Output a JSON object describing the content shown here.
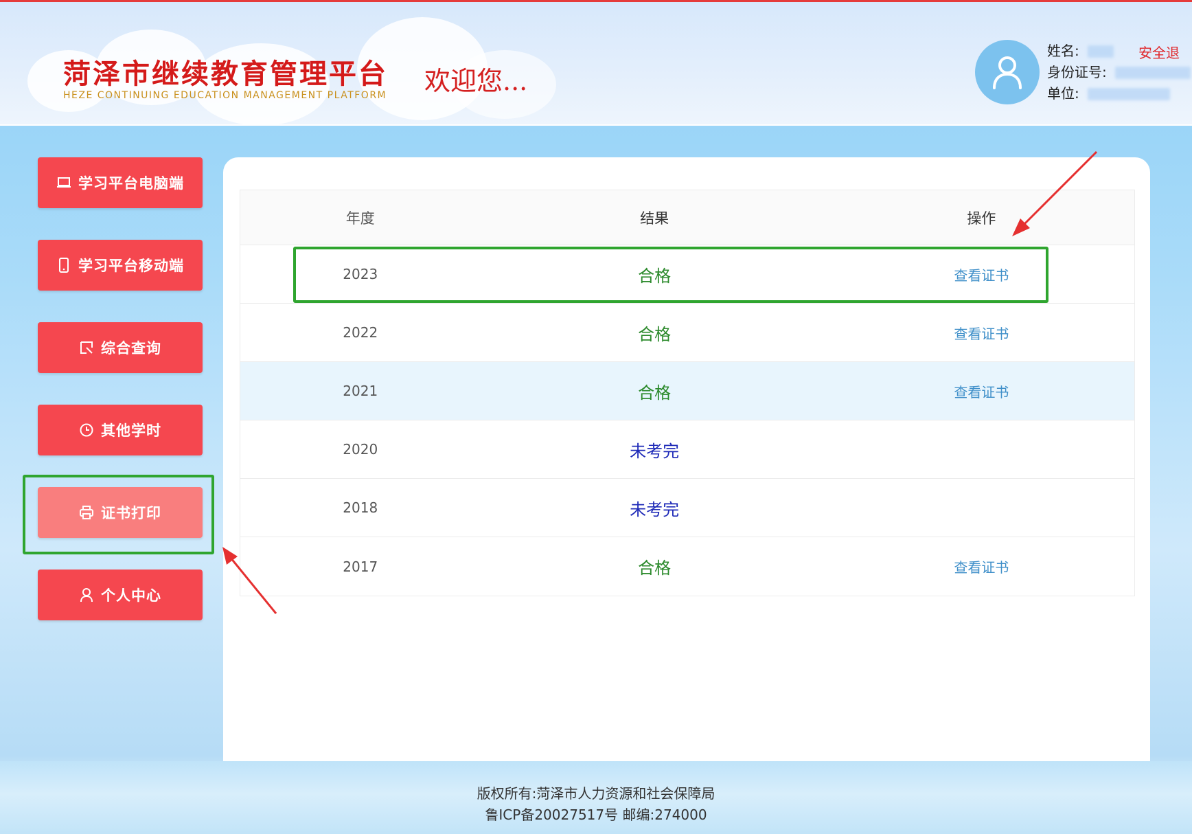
{
  "header": {
    "title": "菏泽市继续教育管理平台",
    "subtitle": "HEZE CONTINUING EDUCATION MANAGEMENT PLATFORM",
    "welcome": "欢迎您...",
    "user": {
      "name_label": "姓名:",
      "id_label": "身份证号:",
      "unit_label": "单位:",
      "logout": "安全退"
    }
  },
  "sidebar": {
    "items": [
      {
        "label": "学习平台电脑端",
        "icon": "laptop-icon"
      },
      {
        "label": "学习平台移动端",
        "icon": "mobile-icon"
      },
      {
        "label": "综合查询",
        "icon": "query-icon"
      },
      {
        "label": "其他学时",
        "icon": "clock-icon"
      },
      {
        "label": "证书打印",
        "icon": "printer-icon",
        "active": true
      },
      {
        "label": "个人中心",
        "icon": "user-icon"
      }
    ]
  },
  "table": {
    "headers": [
      "年度",
      "结果",
      "操作"
    ],
    "rows": [
      {
        "year": "2023",
        "result": "合格",
        "action": "查看证书"
      },
      {
        "year": "2022",
        "result": "合格",
        "action": "查看证书"
      },
      {
        "year": "2021",
        "result": "合格",
        "action": "查看证书"
      },
      {
        "year": "2020",
        "result": "未考完",
        "action": ""
      },
      {
        "year": "2018",
        "result": "未考完",
        "action": ""
      },
      {
        "year": "2017",
        "result": "合格",
        "action": "查看证书"
      }
    ]
  },
  "footer": {
    "line1": "版权所有:菏泽市人力资源和社会保障局",
    "line2": "鲁ICP备20027517号 邮编:274000"
  },
  "colors": {
    "accent_red": "#f5474f",
    "active_red": "#f97e7e",
    "pass_green": "#2c8a2c",
    "pending_blue": "#1f2bb8",
    "link_blue": "#3f8fc9",
    "highlight_green": "#2fa52f",
    "arrow_red": "#e53030"
  }
}
